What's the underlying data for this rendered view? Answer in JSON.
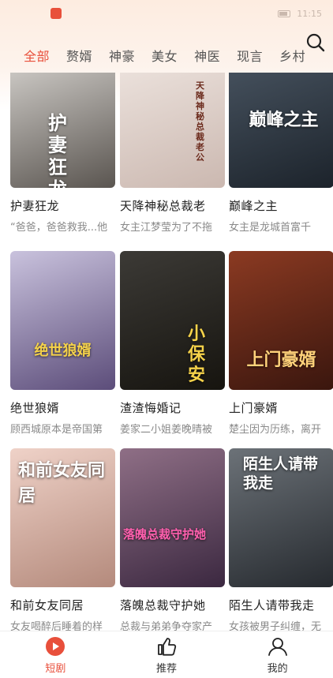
{
  "status_bar": {
    "time": "11:15"
  },
  "tabs": [
    {
      "label": "全部",
      "active": true
    },
    {
      "label": "赘婿",
      "active": false
    },
    {
      "label": "神豪",
      "active": false
    },
    {
      "label": "美女",
      "active": false
    },
    {
      "label": "神医",
      "active": false
    },
    {
      "label": "现言",
      "active": false
    },
    {
      "label": "乡村",
      "active": false
    }
  ],
  "dramas": [
    {
      "title": "护妻狂龙",
      "desc": "“爸爸，爸爸救我...他",
      "poster_text": "护妻狂龙",
      "colors": [
        "#d9d6d2",
        "#5a5550"
      ]
    },
    {
      "title": "天降神秘总裁老",
      "desc": "女主江梦莹为了不拖",
      "poster_text": "天降神秘总裁老公",
      "colors": [
        "#efe6e1",
        "#cbb8b0"
      ]
    },
    {
      "title": "巅峰之主",
      "desc": "女主是龙城首富千",
      "poster_text": "巅峰之主",
      "colors": [
        "#4a5663",
        "#1c232b"
      ]
    },
    {
      "title": "绝世狼婿",
      "desc": "顾西城原本是帝国第",
      "poster_text": "绝世狼婿",
      "colors": [
        "#c9c2dd",
        "#5c4d7a"
      ]
    },
    {
      "title": "渣渣悔婚记",
      "desc": "姜家二小姐姜晚晴被",
      "poster_text": "小保安",
      "colors": [
        "#3c3a36",
        "#16140f"
      ]
    },
    {
      "title": "上门豪婿",
      "desc": "楚尘因为历练，离开",
      "poster_text": "上门豪婿",
      "colors": [
        "#8b3a22",
        "#3a160e"
      ]
    },
    {
      "title": "和前女友同居",
      "desc": "女友喝醉后睡着的样",
      "poster_text": "和前女友同居",
      "colors": [
        "#efd2c8",
        "#b48a7c"
      ]
    },
    {
      "title": "落魄总裁守护她",
      "desc": "总裁与弟弟争夺家产",
      "poster_text": "落魄总裁守护她",
      "colors": [
        "#8f6f86",
        "#3b2840"
      ]
    },
    {
      "title": "陌生人请带我走",
      "desc": "女孩被男子纠缠，无",
      "poster_text": "陌生人请带我走",
      "colors": [
        "#6c7278",
        "#262a2f"
      ]
    }
  ],
  "bottom_nav": [
    {
      "label": "短剧",
      "icon": "play-circle-icon",
      "active": true
    },
    {
      "label": "推荐",
      "icon": "thumbs-up-icon",
      "active": false
    },
    {
      "label": "我的",
      "icon": "user-icon",
      "active": false
    }
  ],
  "accent_color": "#e84f3b"
}
